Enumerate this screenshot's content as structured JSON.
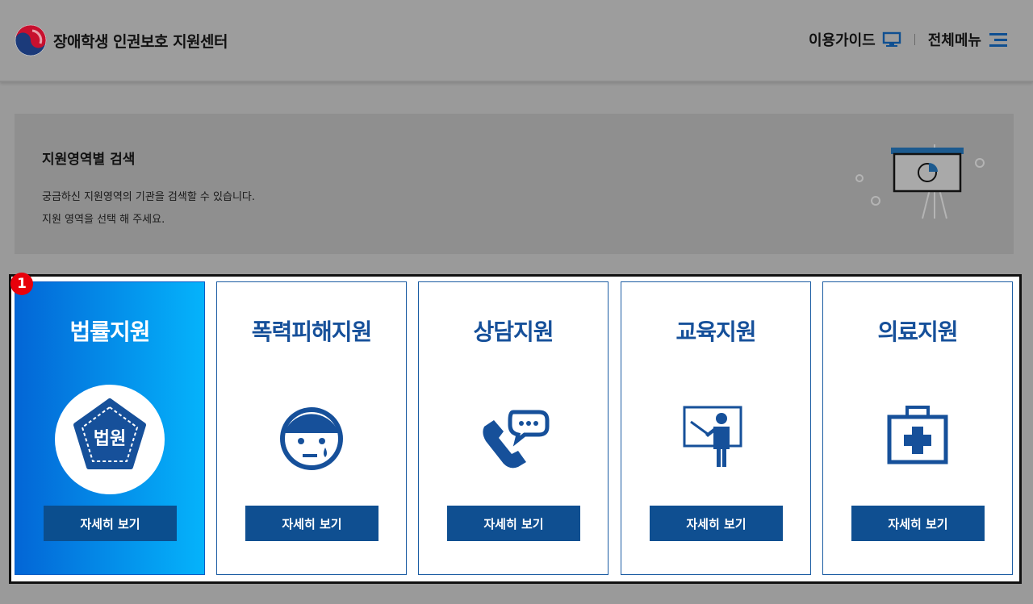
{
  "header": {
    "site_title": "장애학생 인권보호 지원센터",
    "guide_label": "이용가이드",
    "menu_label": "전체메뉴"
  },
  "intro": {
    "title": "지원영역별 검색",
    "desc_line1": "궁금하신 지원영역의 기관을 검색할 수 있습니다.",
    "desc_line2": "지원 영역을 선택 해 주세요."
  },
  "highlight_badge": "1",
  "categories": [
    {
      "title": "법률지원",
      "icon": "court-emblem-icon",
      "icon_text": "법원",
      "button": "자세히 보기",
      "active": true
    },
    {
      "title": "폭력피해지원",
      "icon": "crying-face-icon",
      "button": "자세히 보기",
      "active": false
    },
    {
      "title": "상담지원",
      "icon": "phone-chat-icon",
      "button": "자세히 보기",
      "active": false
    },
    {
      "title": "교육지원",
      "icon": "teacher-board-icon",
      "button": "자세히 보기",
      "active": false
    },
    {
      "title": "의료지원",
      "icon": "medical-kit-icon",
      "button": "자세히 보기",
      "active": false
    }
  ],
  "colors": {
    "primary": "#0f4f91",
    "title_blue": "#16509a",
    "active_gradient_start": "#0366d6",
    "active_gradient_end": "#05b3fb",
    "badge": "#e8000b"
  }
}
